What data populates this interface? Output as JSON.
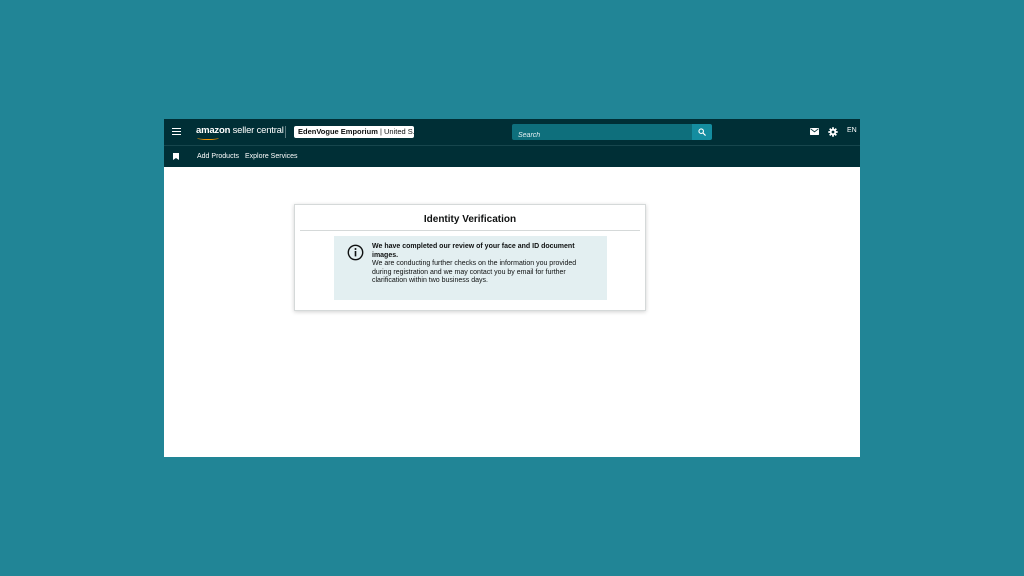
{
  "header": {
    "logo": {
      "brand": "amazon",
      "product": "seller central"
    },
    "account": {
      "store_name": "EdenVogue Emporium",
      "separator": " | ",
      "region": "United S..."
    },
    "search": {
      "placeholder": "Search"
    },
    "language": "EN"
  },
  "icons": {
    "menu": "hamburger-menu-icon",
    "search": "search-icon",
    "mail": "mail-icon",
    "settings": "gear-icon",
    "bookmark": "bookmark-icon",
    "info": "info-icon"
  },
  "subnav": {
    "items": [
      {
        "label": "Add Products"
      },
      {
        "label": "Explore Services"
      }
    ]
  },
  "card": {
    "title": "Identity Verification",
    "alert": {
      "heading": "We have completed our review of your face and ID document images.",
      "body": "We are conducting further checks on the information you provided during registration and we may contact you by email for further clarification within two business days."
    }
  },
  "colors": {
    "background": "#218596",
    "header": "#002f36",
    "alert_bg": "#e3eff1",
    "search_button": "#148da0",
    "logo_smile": "#ff9900"
  }
}
